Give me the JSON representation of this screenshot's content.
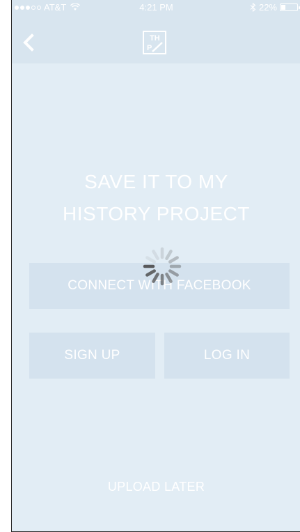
{
  "status_bar": {
    "carrier": "AT&T",
    "time": "4:21 PM",
    "battery": "22%",
    "signal_bars_filled": 3,
    "signal_bars_total": 5,
    "battery_level": 0.22
  },
  "nav": {
    "back_icon": "chevron-left-icon",
    "logo_text_top": "TH",
    "logo_text_bottom": "P"
  },
  "heading": {
    "line1": "SAVE IT TO MY",
    "line2": "HISTORY PROJECT"
  },
  "buttons": {
    "facebook": "CONNECT WITH FACEBOOK",
    "signup": "SIGN UP",
    "login": "LOG IN",
    "upload_later": "UPLOAD LATER"
  },
  "spinner": {
    "icon": "loading-spinner-icon"
  },
  "colors": {
    "background": "#e2edf5",
    "nav_background": "#d8e5ef",
    "button_background": "#d4e2ee",
    "text": "#ffffff",
    "spinner": "#4a4a4a"
  }
}
